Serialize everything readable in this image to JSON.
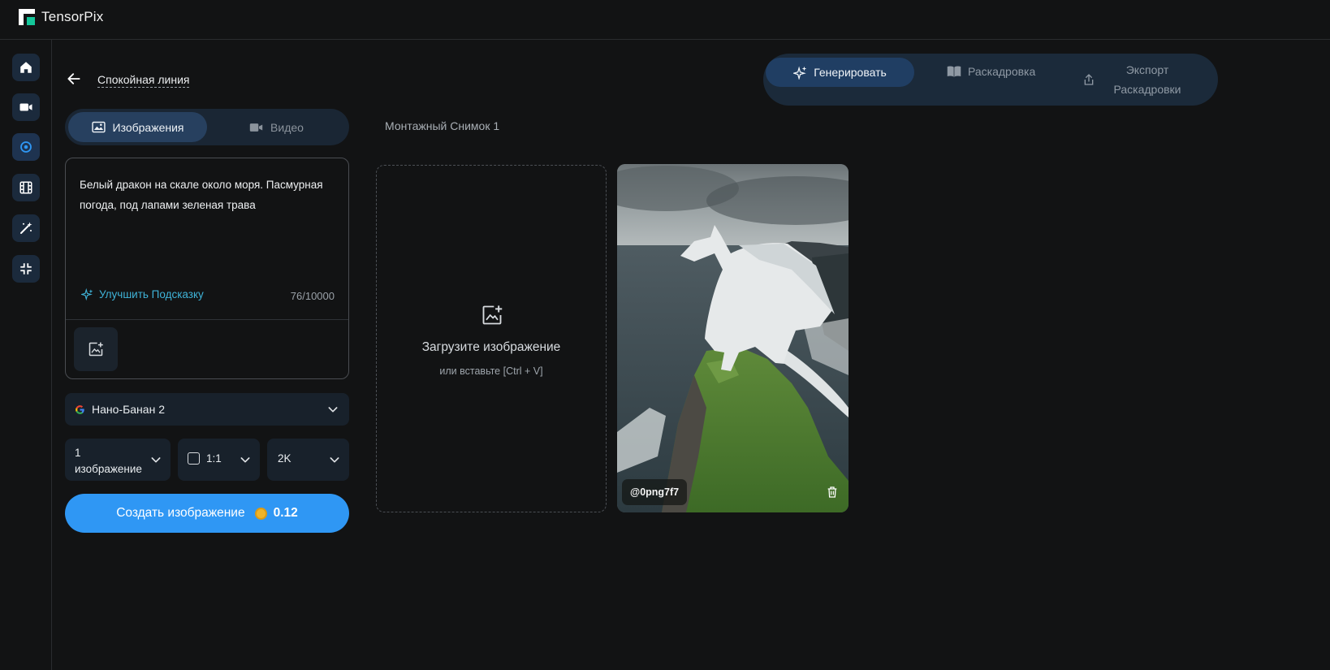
{
  "app": {
    "name": "TensorPix"
  },
  "rail": {
    "items": [
      {
        "icon": "home-icon"
      },
      {
        "icon": "video-camera-icon"
      },
      {
        "icon": "target-icon"
      },
      {
        "icon": "film-icon"
      },
      {
        "icon": "magic-wand-icon"
      },
      {
        "icon": "collapse-icon"
      }
    ]
  },
  "project": {
    "name": "Спокойная линия"
  },
  "mode_tabs": {
    "images": "Изображения",
    "video": "Видео",
    "active": "images"
  },
  "prompt": {
    "text": "Белый дракон на скале около моря. Пасмурная погода, под лапами зеленая трава",
    "enhance_label": "Улучшить Подсказку",
    "counter": "76/10000"
  },
  "model": {
    "name": "Нано-Банан 2"
  },
  "options": {
    "count": "1 изображение",
    "ratio": "1:1",
    "resolution": "2K"
  },
  "create": {
    "label": "Создать изображение",
    "cost": "0.12"
  },
  "actions": {
    "generate": "Генерировать",
    "storyboard": "Раскадровка",
    "export": "Экспорт Раскадровки"
  },
  "shot": {
    "title": "Монтажный Снимок 1"
  },
  "upload": {
    "title": "Загрузите изображение",
    "subtitle": "или вставьте [Ctrl + V]"
  },
  "result": {
    "tag": "@0png7f7"
  },
  "colors": {
    "accent": "#2f97f4",
    "tab_active": "#27405f",
    "link": "#3fb3d8"
  }
}
